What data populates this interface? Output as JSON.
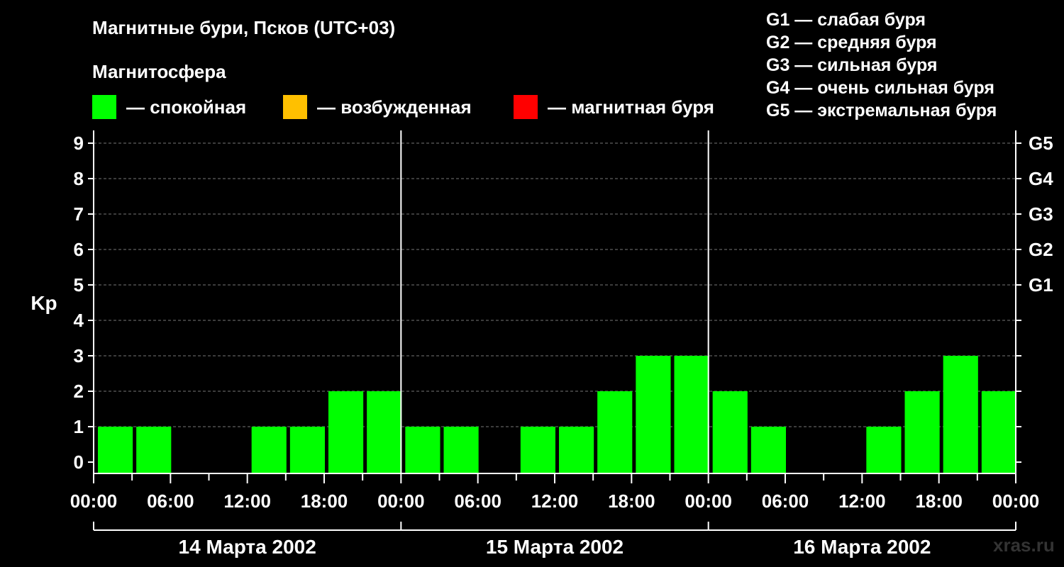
{
  "header": {
    "title": "Магнитные бури, Псков (UTC+03)",
    "subtitle": "Магнитосфера"
  },
  "legend": [
    {
      "label": "— спокойная",
      "color": "#00ff00"
    },
    {
      "label": "— возбужденная",
      "color": "#ffc000"
    },
    {
      "label": "— магнитная буря",
      "color": "#ff0000"
    }
  ],
  "g_legend": [
    "G1 — слабая буря",
    "G2 — средняя буря",
    "G3 — сильная буря",
    "G4 — очень сильная буря",
    "G5 — экстремальная буря"
  ],
  "watermark": "xras.ru",
  "chart_data": {
    "type": "bar",
    "ylabel": "Kp",
    "ylim": [
      0,
      9
    ],
    "y_ticks": [
      "0",
      "1",
      "2",
      "3",
      "4",
      "5",
      "6",
      "7",
      "8",
      "9"
    ],
    "right_ticks": [
      {
        "y": 5,
        "label": "G1"
      },
      {
        "y": 6,
        "label": "G2"
      },
      {
        "y": 7,
        "label": "G3"
      },
      {
        "y": 8,
        "label": "G4"
      },
      {
        "y": 9,
        "label": "G5"
      }
    ],
    "x_tick_labels": [
      "00:00",
      "06:00",
      "12:00",
      "18:00",
      "00:00",
      "06:00",
      "12:00",
      "18:00",
      "00:00",
      "06:00",
      "12:00",
      "18:00",
      "00:00"
    ],
    "days": [
      "14 Марта 2002",
      "15 Марта 2002",
      "16 Марта 2002"
    ],
    "bar_interval_hours": 3,
    "values": [
      1,
      1,
      0,
      0,
      1,
      1,
      2,
      2,
      1,
      1,
      0,
      1,
      1,
      2,
      3,
      3,
      2,
      1,
      0,
      0,
      1,
      2,
      3,
      2
    ],
    "bar_color": "#00ff00",
    "grid": true
  }
}
